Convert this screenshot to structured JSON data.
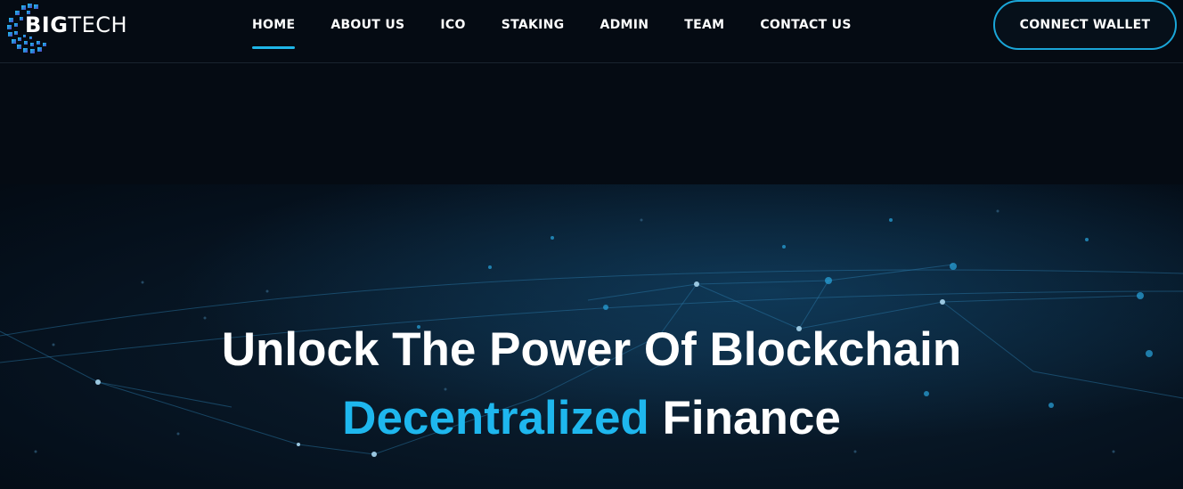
{
  "brand": {
    "name_bold": "BIG",
    "name_light": "TECH",
    "logo_icon": "globe-grid-icon"
  },
  "nav": {
    "items": [
      {
        "label": "HOME",
        "active": true
      },
      {
        "label": "ABOUT US",
        "active": false
      },
      {
        "label": "ICO",
        "active": false
      },
      {
        "label": "STAKING",
        "active": false
      },
      {
        "label": "ADMIN",
        "active": false
      },
      {
        "label": "TEAM",
        "active": false
      },
      {
        "label": "CONTACT US",
        "active": false
      }
    ]
  },
  "header": {
    "connect_label": "CONNECT WALLET"
  },
  "hero": {
    "headline": "Unlock The Power Of Blockchain",
    "sub_accent": "Decentralized",
    "sub_plain": "Finance"
  },
  "colors": {
    "accent": "#1eb7ee",
    "background": "#050b13",
    "text": "#ffffff"
  }
}
